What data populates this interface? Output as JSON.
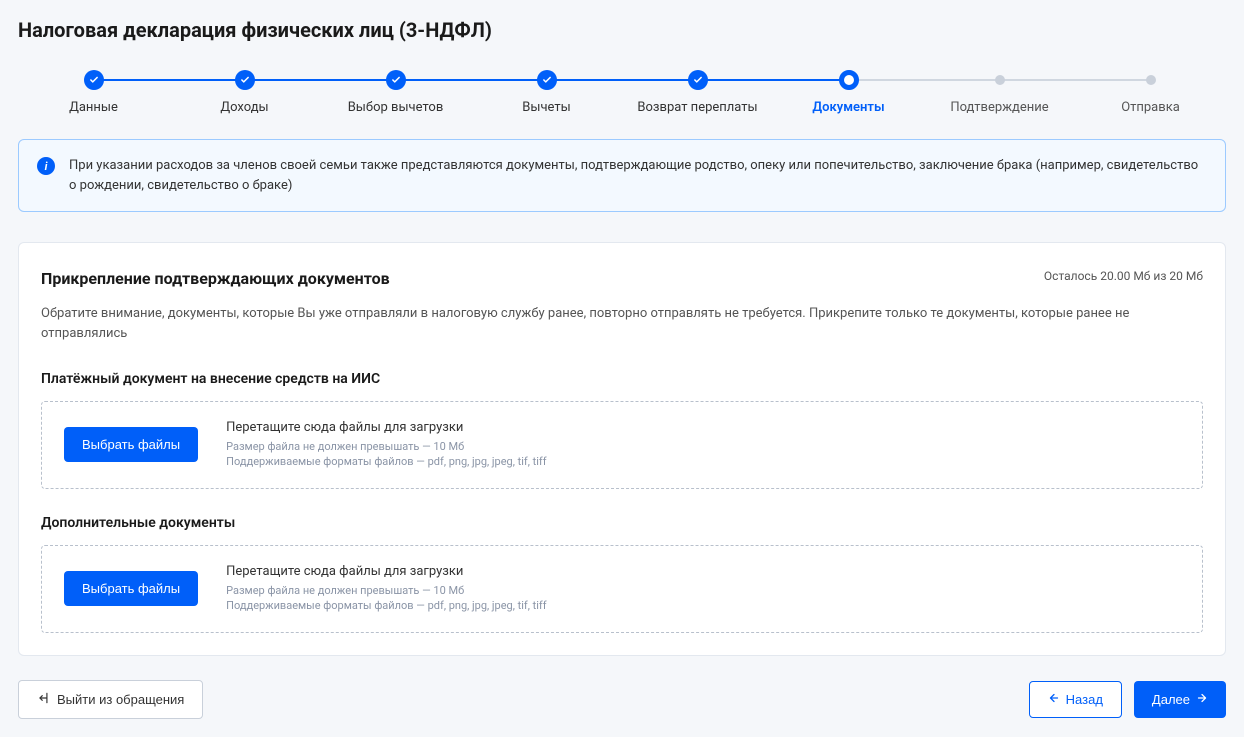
{
  "page": {
    "title": "Налоговая декларация физических лиц (3-НДФЛ)"
  },
  "stepper": {
    "steps": [
      {
        "label": "Данные",
        "status": "done"
      },
      {
        "label": "Доходы",
        "status": "done"
      },
      {
        "label": "Выбор вычетов",
        "status": "done"
      },
      {
        "label": "Вычеты",
        "status": "done"
      },
      {
        "label": "Возврат переплаты",
        "status": "done"
      },
      {
        "label": "Документы",
        "status": "active"
      },
      {
        "label": "Подтверждение",
        "status": "future"
      },
      {
        "label": "Отправка",
        "status": "future"
      }
    ]
  },
  "info": {
    "text": "При указании расходов за членов своей семьи также представляются документы, подтверждающие родство, опеку или попечительство, заключение брака (например, свидетельство о рождении, свидетельство о браке)"
  },
  "attach": {
    "title": "Прикрепление подтверждающих документов",
    "storage": "Осталось 20.00 Мб из 20 Мб",
    "subtext": "Обратите внимание, документы, которые Вы уже отправляли в налоговую службу ранее, повторно отправлять не требуется. Прикрепите только те документы, которые ранее не отправлялись",
    "sections": [
      {
        "title": "Платёжный документ на внесение средств на ИИС",
        "button": "Выбрать файлы",
        "drag_text": "Перетащите сюда файлы для загрузки",
        "size_text": "Размер файла не должен превышать — 10 Мб",
        "format_text": "Поддерживаемые форматы файлов — pdf, png, jpg, jpeg, tif, tiff"
      },
      {
        "title": "Дополнительные документы",
        "button": "Выбрать файлы",
        "drag_text": "Перетащите сюда файлы для загрузки",
        "size_text": "Размер файла не должен превышать — 10 Мб",
        "format_text": "Поддерживаемые форматы файлов — pdf, png, jpg, jpeg, tif, tiff"
      }
    ]
  },
  "footer": {
    "exit": "Выйти из обращения",
    "back": "Назад",
    "next": "Далее"
  }
}
